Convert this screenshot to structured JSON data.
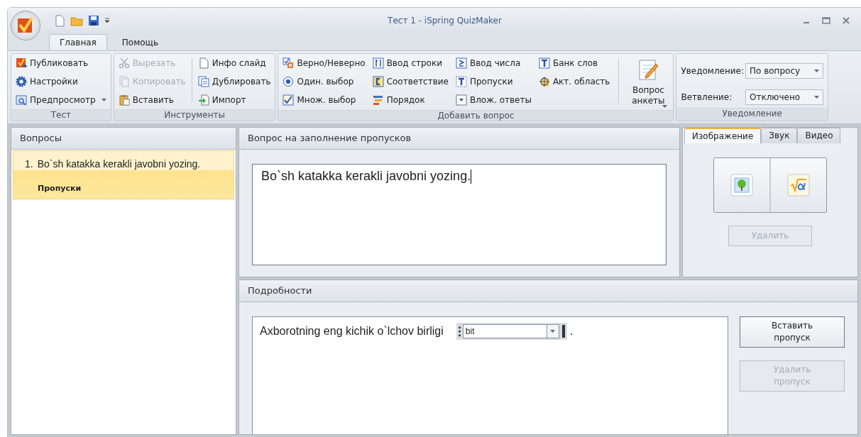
{
  "window": {
    "title": "Тест 1 - iSpring QuizMaker"
  },
  "ribbon_tabs": [
    {
      "label": "Главная",
      "selected": true
    },
    {
      "label": "Помощь",
      "selected": false
    }
  ],
  "ribbon_groups": [
    {
      "label": "Тест",
      "columns": [
        [
          {
            "label": "Публиковать",
            "disabled": false,
            "dropdown": false
          },
          {
            "label": "Настройки",
            "disabled": false,
            "dropdown": false
          },
          {
            "label": "Предпросмотр",
            "disabled": false,
            "dropdown": true
          }
        ]
      ]
    },
    {
      "label": "Инструменты",
      "columns": [
        [
          {
            "label": "Вырезать",
            "disabled": true,
            "dropdown": false
          },
          {
            "label": "Копировать",
            "disabled": true,
            "dropdown": false
          },
          {
            "label": "Вставить",
            "disabled": false,
            "dropdown": false
          }
        ],
        [
          {
            "label": "Инфо слайд",
            "disabled": false,
            "dropdown": false
          },
          {
            "label": "Дублировать",
            "disabled": false,
            "dropdown": false
          },
          {
            "label": "Импорт",
            "disabled": false,
            "dropdown": false
          }
        ]
      ]
    },
    {
      "label": "Добавить вопрос",
      "columns": [
        [
          {
            "label": "Верно/Неверно",
            "disabled": false,
            "dropdown": false
          },
          {
            "label": "Один. выбор",
            "disabled": false,
            "dropdown": false
          },
          {
            "label": "Множ. выбор",
            "disabled": false,
            "dropdown": false
          }
        ],
        [
          {
            "label": "Ввод строки",
            "disabled": false,
            "dropdown": false
          },
          {
            "label": "Соответствие",
            "disabled": false,
            "dropdown": false
          },
          {
            "label": "Порядок",
            "disabled": false,
            "dropdown": false
          }
        ],
        [
          {
            "label": "Ввод числа",
            "disabled": false,
            "dropdown": false
          },
          {
            "label": "Пропуски",
            "disabled": false,
            "dropdown": false
          },
          {
            "label": "Влож. ответы",
            "disabled": false,
            "dropdown": false
          }
        ],
        [
          {
            "label": "Банк слов",
            "disabled": false,
            "dropdown": false
          },
          {
            "label": "Акт. область",
            "disabled": false,
            "dropdown": false
          }
        ]
      ],
      "large_button": {
        "label": "Вопрос анкеты"
      }
    },
    {
      "label": "Уведомление",
      "fields": [
        {
          "label": "Уведомление:",
          "value": "По вопросу"
        },
        {
          "label": "Ветвление:",
          "value": "Отключено"
        }
      ]
    }
  ],
  "questions_panel": {
    "title": "Вопросы",
    "items": [
      {
        "number": "1.",
        "text": "Bo`sh katakka kerakli javobni yozing.",
        "type": "Пропуски",
        "selected": true
      }
    ]
  },
  "question_panel": {
    "title": "Вопрос на заполнение пропусков",
    "text": "Bo`sh katakka kerakli javobni yozing."
  },
  "media_panel": {
    "tabs": [
      {
        "label": "Изображение",
        "selected": true
      },
      {
        "label": "Звук",
        "selected": false
      },
      {
        "label": "Видео",
        "selected": false
      }
    ],
    "delete_button": {
      "label": "Удалить",
      "disabled": true
    }
  },
  "details_panel": {
    "title": "Подробности",
    "sentence": "Axborotning eng kichik o`lchov birligi",
    "blank": {
      "value": "bit"
    },
    "ending": ".",
    "buttons": [
      {
        "label": "Вставить пропуск",
        "disabled": false
      },
      {
        "label": "Удалить пропуск",
        "disabled": true
      }
    ]
  }
}
